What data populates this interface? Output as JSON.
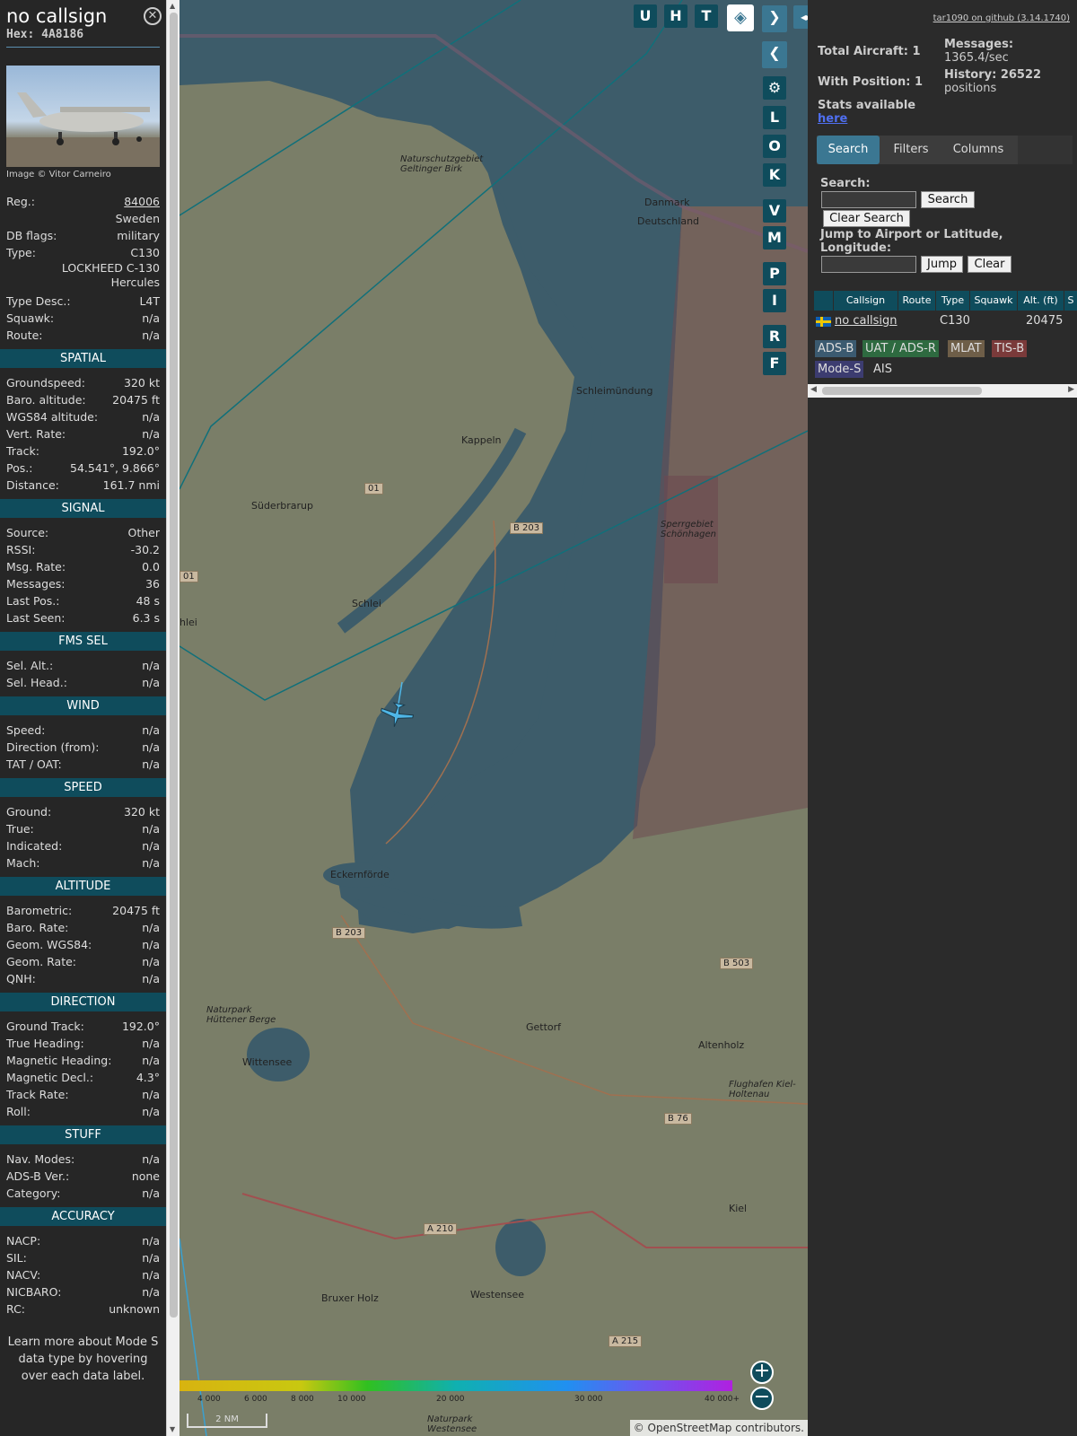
{
  "detail": {
    "callsign": "no callsign",
    "hex": "Hex: 4A8186",
    "image_credit": "Image © Vitor Carneiro",
    "reg_label": "Reg.:",
    "reg": "84006",
    "country": "Sweden",
    "dbflags_label": "DB flags:",
    "dbflags": "military",
    "type_label": "Type:",
    "type": "C130",
    "type_full": "LOCKHEED C-130 Hercules",
    "typedesc_label": "Type Desc.:",
    "typedesc": "L4T",
    "squawk_label": "Squawk:",
    "squawk": "n/a",
    "route_label": "Route:",
    "route": "n/a"
  },
  "sections": [
    {
      "title": "SPATIAL",
      "rows": [
        [
          "Groundspeed:",
          "320 kt"
        ],
        [
          "Baro. altitude:",
          "20475 ft"
        ],
        [
          "WGS84 altitude:",
          "n/a"
        ],
        [
          "Vert. Rate:",
          "n/a"
        ],
        [
          "Track:",
          "192.0°"
        ],
        [
          "Pos.:",
          "54.541°, 9.866°"
        ],
        [
          "Distance:",
          "161.7 nmi"
        ]
      ]
    },
    {
      "title": "SIGNAL",
      "rows": [
        [
          "Source:",
          "Other"
        ],
        [
          "RSSI:",
          "-30.2"
        ],
        [
          "Msg. Rate:",
          "0.0"
        ],
        [
          "Messages:",
          "36"
        ],
        [
          "Last Pos.:",
          "48 s"
        ],
        [
          "Last Seen:",
          "6.3 s"
        ]
      ]
    },
    {
      "title": "FMS SEL",
      "rows": [
        [
          "Sel. Alt.:",
          "n/a"
        ],
        [
          "Sel. Head.:",
          "n/a"
        ]
      ]
    },
    {
      "title": "WIND",
      "rows": [
        [
          "Speed:",
          "n/a"
        ],
        [
          "Direction (from):",
          "n/a"
        ],
        [
          "TAT / OAT:",
          "n/a"
        ]
      ]
    },
    {
      "title": "SPEED",
      "rows": [
        [
          "Ground:",
          "320 kt"
        ],
        [
          "True:",
          "n/a"
        ],
        [
          "Indicated:",
          "n/a"
        ],
        [
          "Mach:",
          "n/a"
        ]
      ]
    },
    {
      "title": "ALTITUDE",
      "rows": [
        [
          "Barometric:",
          "20475 ft"
        ],
        [
          "Baro. Rate:",
          "n/a"
        ],
        [
          "Geom. WGS84:",
          "n/a"
        ],
        [
          "Geom. Rate:",
          "n/a"
        ],
        [
          "QNH:",
          "n/a"
        ]
      ]
    },
    {
      "title": "DIRECTION",
      "rows": [
        [
          "Ground Track:",
          "192.0°"
        ],
        [
          "True Heading:",
          "n/a"
        ],
        [
          "Magnetic Heading:",
          "n/a"
        ],
        [
          "Magnetic Decl.:",
          "4.3°"
        ],
        [
          "Track Rate:",
          "n/a"
        ],
        [
          "Roll:",
          "n/a"
        ]
      ]
    },
    {
      "title": "STUFF",
      "rows": [
        [
          "Nav. Modes:",
          "n/a"
        ],
        [
          "ADS-B Ver.:",
          "none"
        ],
        [
          "Category:",
          "n/a"
        ]
      ]
    },
    {
      "title": "ACCURACY",
      "rows": [
        [
          "NACP:",
          "n/a"
        ],
        [
          "SIL:",
          "n/a"
        ],
        [
          "NACV:",
          "n/a"
        ],
        [
          "NICBARO:",
          "n/a"
        ],
        [
          "RC:",
          "unknown"
        ]
      ]
    }
  ],
  "learn_more": "Learn more about Mode S data type by hovering over each data label.",
  "map": {
    "top_buttons": [
      "U",
      "H",
      "T"
    ],
    "side_buttons": [
      "L",
      "O",
      "K",
      "V",
      "M",
      "P",
      "I",
      "R",
      "F"
    ],
    "labels": [
      "Naturschutzgebiet Geltinger Birk",
      "Danmark",
      "Deutschland",
      "Schleimündung",
      "Kappeln",
      "Süderbrarup",
      "B 203",
      "Schlei",
      "Sperrgebiet Schönhagen",
      "Eckernförde",
      "B 203",
      "B 503",
      "Naturpark Hüttener Berge",
      "Wittensee",
      "Gettorf",
      "Altenholz",
      "Flughafen Kiel-Holtenau",
      "B 76",
      "Kiel",
      "A 210",
      "Westensee",
      "Bruxer Holz",
      "A 215",
      "Naturpark Westensee",
      "hlei",
      "01",
      "01"
    ],
    "altitude_ticks": [
      "4 000",
      "6 000",
      "8 000",
      "10 000",
      "20 000",
      "30 000",
      "40 000+"
    ],
    "scale": "2 NM",
    "attribution": "© OpenStreetMap contributors.",
    "scheme_colors": [
      "#d8b310",
      "#c8c810",
      "#30c020",
      "#10b0b0",
      "#2090f0",
      "#6060f0",
      "#b020e0"
    ]
  },
  "right": {
    "github": "tar1090 on github (3.14.1740)",
    "total_aircraft": "Total Aircraft: 1",
    "messages_label": "Messages:",
    "messages": "1365.4/sec",
    "with_position": "With Position: 1",
    "history_label": "History: 26522",
    "history_unit": "positions",
    "stats_label": "Stats available",
    "stats_link": "here",
    "tabs": [
      "Search",
      "Filters",
      "Columns"
    ],
    "search_label": "Search:",
    "search_button": "Search",
    "clear_search": "Clear Search",
    "jump_label": "Jump to Airport or Latitude, Longitude:",
    "jump_button": "Jump",
    "clear_button": "Clear",
    "columns": [
      "Callsign",
      "Route",
      "Type",
      "Squawk",
      "Alt. (ft)",
      "S"
    ],
    "row": {
      "callsign": "no callsign",
      "route": "",
      "type": "C130",
      "squawk": "",
      "alt": "20475"
    },
    "legend": [
      "ADS-B",
      "UAT / ADS-R",
      "MLAT",
      "TIS-B",
      "Mode-S",
      "AIS"
    ]
  }
}
